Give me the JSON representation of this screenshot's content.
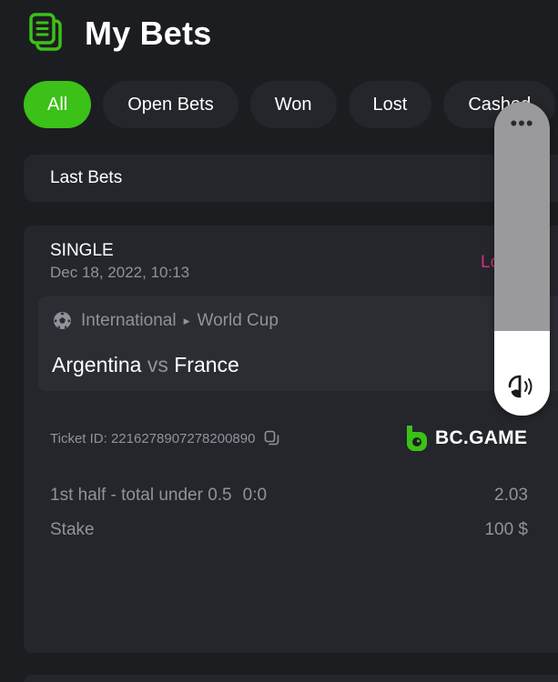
{
  "header": {
    "title": "My Bets",
    "icon": "receipt-icon",
    "accent": "#3bc117"
  },
  "filters": {
    "tabs": [
      {
        "label": "All",
        "active": true
      },
      {
        "label": "Open Bets",
        "active": false
      },
      {
        "label": "Won",
        "active": false
      },
      {
        "label": "Lost",
        "active": false
      },
      {
        "label": "Cashed",
        "active": false
      }
    ]
  },
  "section": {
    "label": "Last Bets"
  },
  "bet": {
    "type": "SINGLE",
    "datetime": "Dec 18, 2022, 10:13",
    "status": "Lost",
    "status_color": "#d62f7a",
    "match": {
      "sport_icon": "soccer-ball-icon",
      "category": "International",
      "separator_icon": "triangle-right-icon",
      "league": "World Cup",
      "home": "Argentina",
      "vs": "vs",
      "away": "France"
    },
    "ticket_label": "Ticket ID: 2216278907278200890",
    "copy_icon": "copy-icon",
    "brand": "BC.GAME",
    "selection": "1st half - total under 0.5",
    "score": "0:0",
    "odds": "2.03",
    "stake_label": "Stake",
    "stake_value": "100 $"
  },
  "volume_overlay": {
    "menu_icon": "more-dots-icon",
    "icon": "volume-icon",
    "level": 0.27
  }
}
